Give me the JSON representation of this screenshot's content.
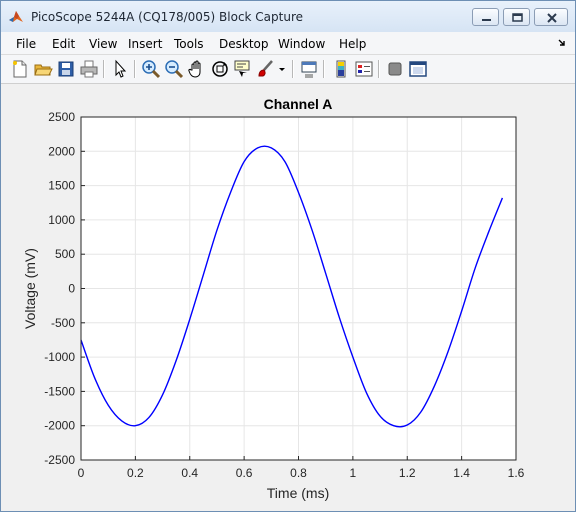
{
  "window": {
    "title": "PicoScope 5244A (CQ178/005) Block Capture"
  },
  "menu": [
    "File",
    "Edit",
    "View",
    "Insert",
    "Tools",
    "Desktop",
    "Window",
    "Help"
  ],
  "toolbar": {
    "buttons": [
      "new-figure",
      "open-file",
      "save",
      "print",
      "edit-plot",
      "zoom-in",
      "zoom-out",
      "pan",
      "rotate-3d",
      "data-cursor",
      "brush",
      "link-plot",
      "insert-colorbar",
      "insert-legend",
      "hide-plot-tools",
      "show-plot-tools"
    ]
  },
  "chart_data": {
    "type": "line",
    "title": "Channel A",
    "xlabel": "Time (ms)",
    "ylabel": "Voltage (mV)",
    "xlim": [
      0,
      1.6
    ],
    "ylim": [
      -2500,
      2500
    ],
    "xticks": [
      "0",
      "0.2",
      "0.4",
      "0.6",
      "0.8",
      "1",
      "1.2",
      "1.4",
      "1.6"
    ],
    "yticks": [
      "2500",
      "2000",
      "1500",
      "1000",
      "500",
      "0",
      "-500",
      "-1000",
      "-1500",
      "-2000",
      "-2500"
    ],
    "grid": true,
    "series": [
      {
        "color": "#0000ff",
        "x": [
          0,
          0.05,
          0.1,
          0.15,
          0.2,
          0.25,
          0.3,
          0.35,
          0.4,
          0.45,
          0.5,
          0.55,
          0.6,
          0.65,
          0.7,
          0.75,
          0.8,
          0.85,
          0.9,
          0.95,
          1.0,
          1.05,
          1.1,
          1.15,
          1.2,
          1.25,
          1.3,
          1.35,
          1.4,
          1.45,
          1.5,
          1.55
        ],
        "y": [
          -750,
          -1300,
          -1700,
          -1930,
          -2000,
          -1880,
          -1550,
          -1050,
          -450,
          200,
          850,
          1400,
          1850,
          2050,
          2050,
          1850,
          1400,
          850,
          220,
          -420,
          -1000,
          -1520,
          -1860,
          -2000,
          -1990,
          -1800,
          -1420,
          -920,
          -330,
          300,
          830,
          1320
        ]
      }
    ]
  }
}
